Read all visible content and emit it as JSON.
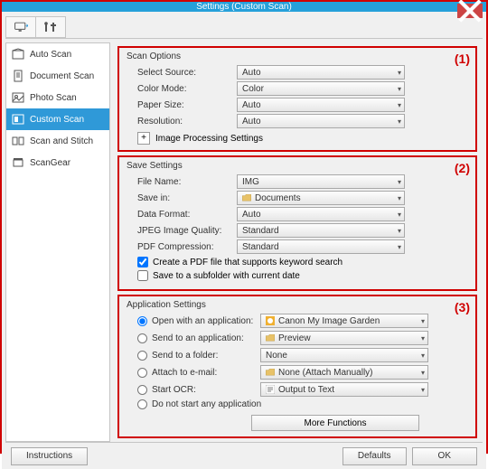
{
  "window": {
    "title": "Settings (Custom Scan)"
  },
  "sidebar": {
    "items": [
      {
        "label": "Auto Scan"
      },
      {
        "label": "Document Scan"
      },
      {
        "label": "Photo Scan"
      },
      {
        "label": "Custom Scan"
      },
      {
        "label": "Scan and Stitch"
      },
      {
        "label": "ScanGear"
      }
    ]
  },
  "markers": {
    "g1": "(1)",
    "g2": "(2)",
    "g3": "(3)"
  },
  "scan": {
    "title": "Scan Options",
    "source_lbl": "Select Source:",
    "source_val": "Auto",
    "color_lbl": "Color Mode:",
    "color_val": "Color",
    "paper_lbl": "Paper Size:",
    "paper_val": "Auto",
    "res_lbl": "Resolution:",
    "res_val": "Auto",
    "ips_label": "Image Processing Settings"
  },
  "save": {
    "title": "Save Settings",
    "name_lbl": "File Name:",
    "name_val": "IMG",
    "savein_lbl": "Save in:",
    "savein_val": "Documents",
    "fmt_lbl": "Data Format:",
    "fmt_val": "Auto",
    "jpeg_lbl": "JPEG Image Quality:",
    "jpeg_val": "Standard",
    "pdf_lbl": "PDF Compression:",
    "pdf_val": "Standard",
    "chk_keyword": "Create a PDF file that supports keyword search",
    "chk_subfolder": "Save to a subfolder with current date"
  },
  "app": {
    "title": "Application Settings",
    "open_lbl": "Open with an application:",
    "open_val": "Canon My Image Garden",
    "sendapp_lbl": "Send to an application:",
    "sendapp_val": "Preview",
    "sendfld_lbl": "Send to a folder:",
    "sendfld_val": "None",
    "attach_lbl": "Attach to e-mail:",
    "attach_val": "None (Attach Manually)",
    "ocr_lbl": "Start OCR:",
    "ocr_val": "Output to Text",
    "none_lbl": "Do not start any application",
    "more": "More Functions"
  },
  "footer": {
    "instructions": "Instructions",
    "defaults": "Defaults",
    "ok": "OK"
  }
}
